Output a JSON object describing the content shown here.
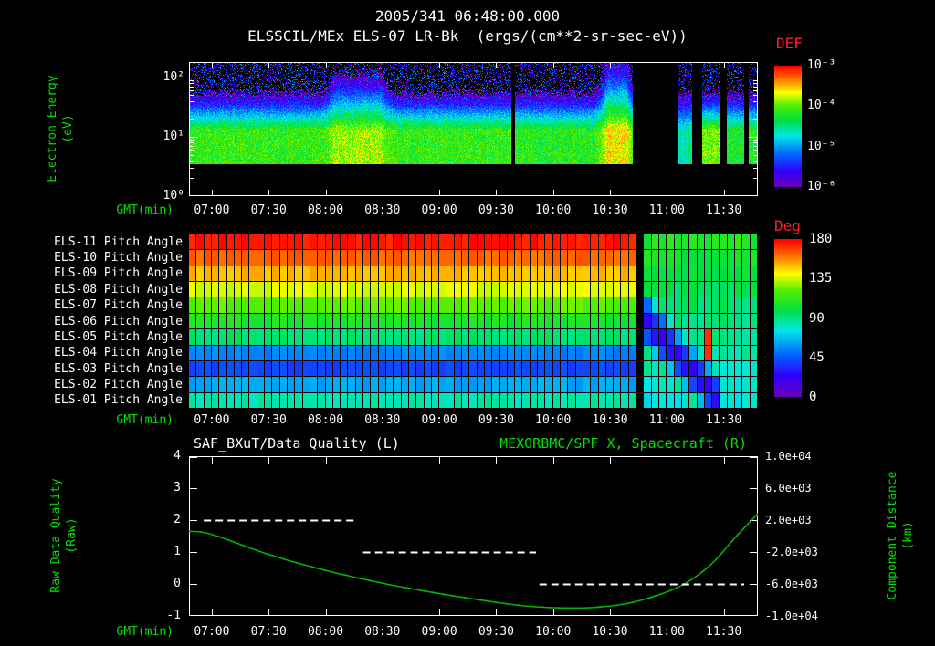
{
  "title": "2005/341 06:48:00.000",
  "subtitle": "ELSSCIL/MEx ELS-07 LR-Bk  (ergs/(cm**2-sr-sec-eV))",
  "colors": {
    "background": "#000000",
    "text_white": "#ffffff",
    "axis_green": "#00e000",
    "label_red": "#ff2020",
    "curve_green": "#00b400",
    "frame_white": "#ffffff"
  },
  "time_axis": {
    "label": "GMT(min)",
    "start_hour": 6.8,
    "end_hour": 11.8,
    "tick_labels": [
      "07:00",
      "07:30",
      "08:00",
      "08:30",
      "09:00",
      "09:30",
      "10:00",
      "10:30",
      "11:00",
      "11:30"
    ],
    "tick_hours": [
      7,
      7.5,
      8,
      8.5,
      9,
      9.5,
      10,
      10.5,
      11,
      11.5
    ]
  },
  "chart_data": [
    {
      "id": "electron_energy_spectrogram",
      "type": "heatmap",
      "instrument": "ELSSCIL/MEx ELS-07 LR-Bk",
      "units": "ergs/(cm**2-sr-sec-eV)",
      "ylabel_lines": [
        "Electron Energy",
        "(eV)"
      ],
      "xlabel": "GMT(min)",
      "y_scale": "log",
      "y_tick_labels": [
        "10⁰",
        "10¹",
        "10²"
      ],
      "y_tick_values": [
        0,
        1,
        2
      ],
      "y_top_log_ev": 2.26,
      "colorbar": {
        "label": "DEF",
        "tick_labels": [
          "10⁻³",
          "10⁻⁴",
          "10⁻⁵",
          "10⁻⁶"
        ],
        "log_max": -3,
        "log_min": -6
      },
      "band": {
        "cutoff_low_log_ev": 0.54,
        "core_high_log_ev": 1.12,
        "default_top_log_ev": 1.7
      },
      "data_segments": [
        {
          "t": [
            6.8,
            9.635
          ],
          "peak_log_def": -4.25
        },
        {
          "t": [
            9.665,
            10.7
          ],
          "peak_log_def": -4.3
        },
        {
          "t": [
            11.1,
            11.22
          ],
          "peak_log_def": -4.8
        },
        {
          "t": [
            11.31,
            11.47
          ],
          "peak_log_def": -4.05
        },
        {
          "t": [
            11.53,
            11.68
          ],
          "peak_log_def": -4.35
        },
        {
          "t": [
            11.72,
            11.8
          ],
          "peak_log_def": -4.3
        }
      ],
      "dropouts": [
        [
          9.635,
          9.665
        ]
      ],
      "enhancements": [
        {
          "t": [
            8.02,
            8.55
          ],
          "peak_log_def": -3.95,
          "top_log_ev": 2.0
        },
        {
          "t": [
            10.42,
            10.7
          ],
          "peak_log_def": -3.7,
          "top_log_ev": 2.25
        }
      ],
      "noise": {
        "density": 0.3,
        "log_def_range": [
          -6.3,
          -5.2
        ]
      }
    },
    {
      "id": "pitch_angle_panel",
      "type": "heatmap",
      "rows": [
        "ELS-11 Pitch Angle",
        "ELS-10 Pitch Angle",
        "ELS-09 Pitch Angle",
        "ELS-08 Pitch Angle",
        "ELS-07 Pitch Angle",
        "ELS-06 Pitch Angle",
        "ELS-05 Pitch Angle",
        "ELS-04 Pitch Angle",
        "ELS-03 Pitch Angle",
        "ELS-02 Pitch Angle",
        "ELS-01 Pitch Angle"
      ],
      "xlabel": "GMT(min)",
      "colorbar": {
        "label": "Deg",
        "tick_labels": [
          "180",
          "135",
          "90",
          "45",
          "0"
        ],
        "max": 180,
        "min": 0
      },
      "bin_minutes": 4,
      "phase1_angles_top_to_bottom": [
        176,
        163,
        150,
        137,
        122,
        107,
        92,
        55,
        40,
        62,
        84
      ],
      "transition_hour": 10.72,
      "gap_hours": [
        10.72,
        10.8
      ],
      "phase2": {
        "background_angles_top_to_bottom": [
          108,
          104,
          100,
          97,
          94,
          91,
          88,
          85,
          82,
          79,
          76
        ],
        "dark_band": {
          "angle": 18,
          "half_width_rows": 1.15,
          "start": {
            "hour": 10.82,
            "row": 5
          },
          "end": {
            "hour": 11.47,
            "row": 10
          }
        },
        "hot_cells": [
          {
            "hour": 11.39,
            "rows": [
              6,
              7
            ],
            "angle": 172
          }
        ]
      }
    },
    {
      "id": "quality_distance_plot",
      "type": "line",
      "title_left": "SAF_BXuT/Data Quality (L)",
      "title_right": "MEXORBMC/SPF X, Spacecraft (R)",
      "ylabel_left_lines": [
        "Raw Data Quality",
        "(Raw)"
      ],
      "ylabel_right_lines": [
        "Component Distance",
        "(km)"
      ],
      "xlabel": "GMT(min)",
      "left_axis": {
        "max": 4,
        "min": -1,
        "tick_labels": [
          "4",
          "3",
          "2",
          "1",
          "0",
          "-1"
        ],
        "tick_values": [
          4,
          3,
          2,
          1,
          0,
          -1
        ]
      },
      "right_axis": {
        "max": 10000,
        "min": -10000,
        "tick_labels": [
          "1.0e+04",
          "6.0e+03",
          "2.0e+03",
          "-2.0e+03",
          "-6.0e+03",
          "-1.0e+04"
        ],
        "tick_values": [
          10000,
          6000,
          2000,
          -2000,
          -6000,
          -10000
        ]
      },
      "spacecraft_x_km": {
        "hours": [
          6.8,
          7.0,
          7.5,
          8.0,
          8.5,
          9.0,
          9.5,
          9.8,
          10.1,
          10.4,
          10.7,
          11.0,
          11.2,
          11.4,
          11.6,
          11.8
        ],
        "values_km": [
          600,
          200,
          -2300,
          -4300,
          -5900,
          -7200,
          -8300,
          -8800,
          -9000,
          -8900,
          -8300,
          -7000,
          -5600,
          -3400,
          -200,
          2800
        ]
      },
      "quality_segments": [
        {
          "value": 2,
          "t": [
            6.93,
            8.28
          ]
        },
        {
          "value": 1,
          "t": [
            8.33,
            9.85
          ]
        },
        {
          "value": 0,
          "t": [
            9.88,
            11.68
          ]
        }
      ]
    }
  ]
}
